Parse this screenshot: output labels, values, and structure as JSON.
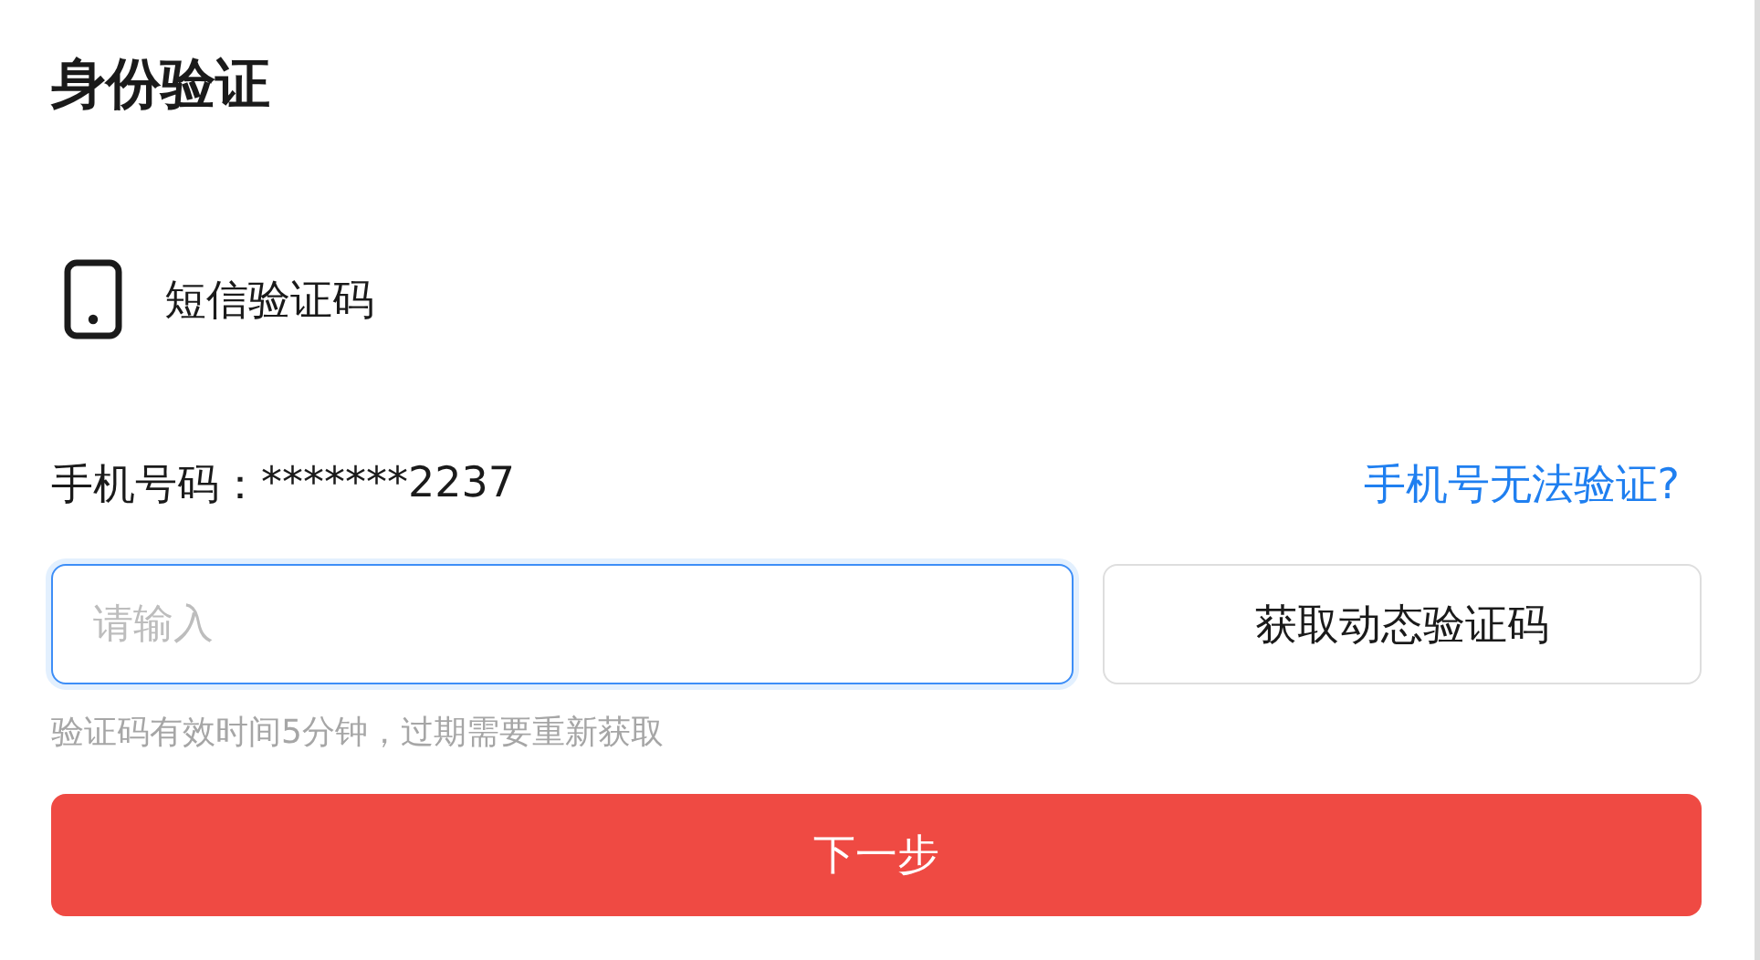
{
  "title": "身份验证",
  "method": {
    "label": "短信验证码"
  },
  "phone": {
    "label": "手机号码：",
    "value": "*******2237",
    "help_link": "手机号无法验证?"
  },
  "code_input": {
    "placeholder": "请输入",
    "focused": true
  },
  "send_button": "获取动态验证码",
  "hint": "验证码有效时间5分钟，过期需要重新获取",
  "next_button": "下一步"
}
